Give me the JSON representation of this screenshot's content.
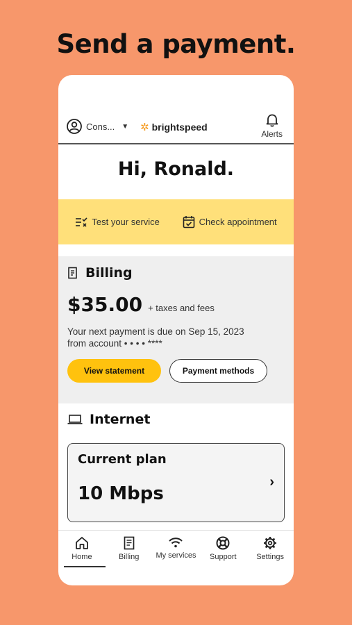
{
  "headline": "Send a payment.",
  "header": {
    "account_label": "Cons...",
    "brand": "brightspeed",
    "alerts_label": "Alerts"
  },
  "greeting": "Hi, Ronald.",
  "quick_actions": [
    {
      "label": "Test your service",
      "icon": "checklist-icon"
    },
    {
      "label": "Check appointment",
      "icon": "calendar-check-icon"
    }
  ],
  "billing": {
    "title": "Billing",
    "amount": "$35.00",
    "amount_suffix": "+ taxes and fees",
    "due_line1": "Your next payment is due on Sep 15, 2023",
    "due_line2": "from account • • • • ****",
    "view_statement": "View statement",
    "payment_methods": "Payment methods"
  },
  "internet": {
    "title": "Internet",
    "plan_label": "Current plan",
    "plan_speed": "10 Mbps"
  },
  "nav": [
    {
      "label": "Home",
      "icon": "home-icon",
      "active": true
    },
    {
      "label": "Billing",
      "icon": "bill-icon",
      "active": false
    },
    {
      "label": "My services",
      "icon": "wifi-icon",
      "active": false
    },
    {
      "label": "Support",
      "icon": "lifebuoy-icon",
      "active": false
    },
    {
      "label": "Settings",
      "icon": "gear-icon",
      "active": false
    }
  ],
  "colors": {
    "background": "#F7976B",
    "quick_bar": "#FFE07A",
    "primary_button": "#FFC20E",
    "brand_accent": "#F59A1E"
  }
}
